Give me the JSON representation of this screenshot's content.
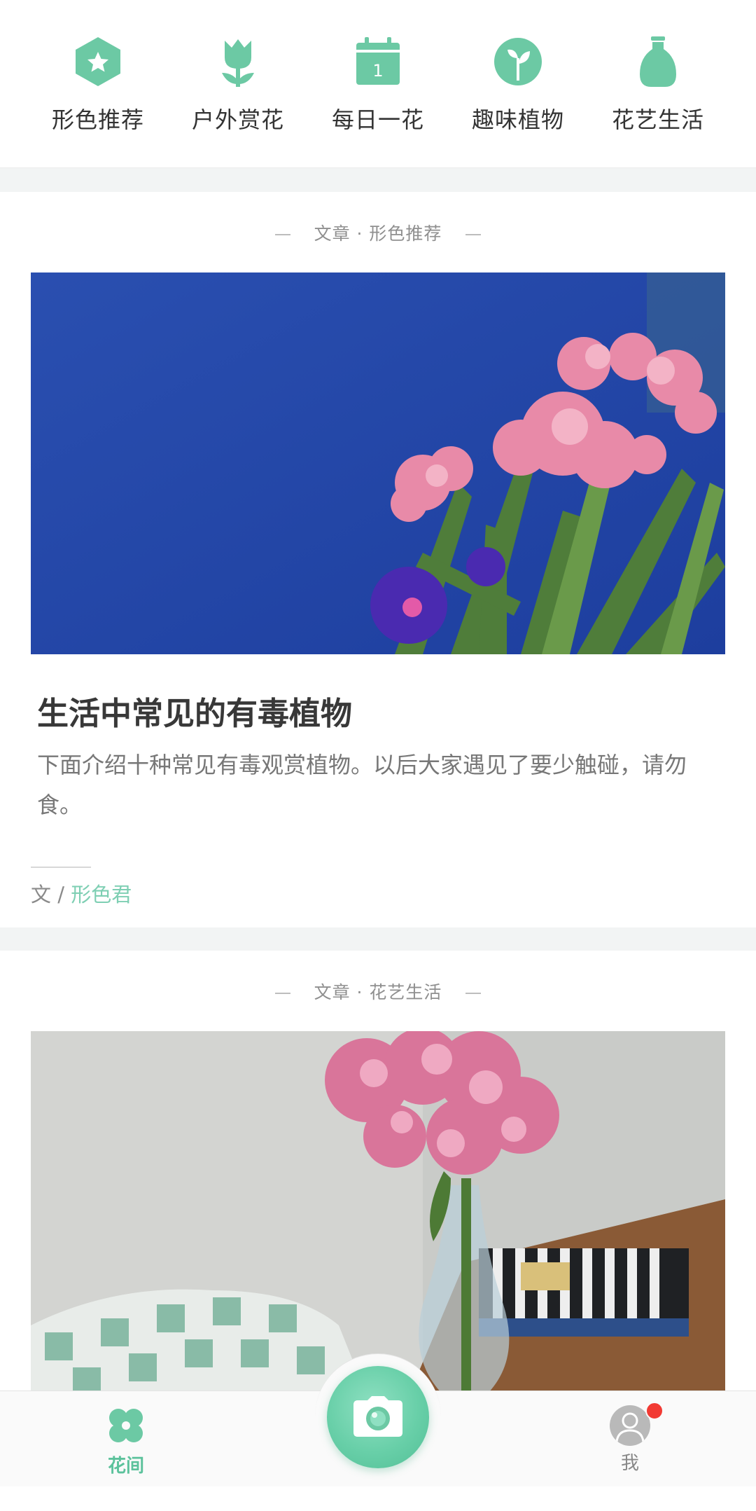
{
  "nav": [
    {
      "label": "形色推荐",
      "icon": "star-hexagon-icon"
    },
    {
      "label": "户外赏花",
      "icon": "tulip-icon"
    },
    {
      "label": "每日一花",
      "icon": "calendar-icon",
      "day": "1"
    },
    {
      "label": "趣味植物",
      "icon": "sprout-icon"
    },
    {
      "label": "花艺生活",
      "icon": "vase-icon"
    }
  ],
  "articles": [
    {
      "tag": "文章 · 形色推荐",
      "image": "pink-oleander-photo",
      "title": "生活中常见的有毒植物",
      "desc": "下面介绍十种常见有毒观赏植物。以后大家遇见了要少触碰，请勿食。",
      "byline_prefix": "文 / ",
      "author": "形色君"
    },
    {
      "tag": "文章 · 花艺生活",
      "image": "hydrangea-vase-photo"
    }
  ],
  "bottom_bar": {
    "home_label": "花间",
    "me_label": "我",
    "camera_icon": "camera-icon",
    "has_notification": true
  },
  "colors": {
    "accent": "#6cc9a4",
    "author": "#7ecfb3",
    "badge": "#f23a33"
  }
}
